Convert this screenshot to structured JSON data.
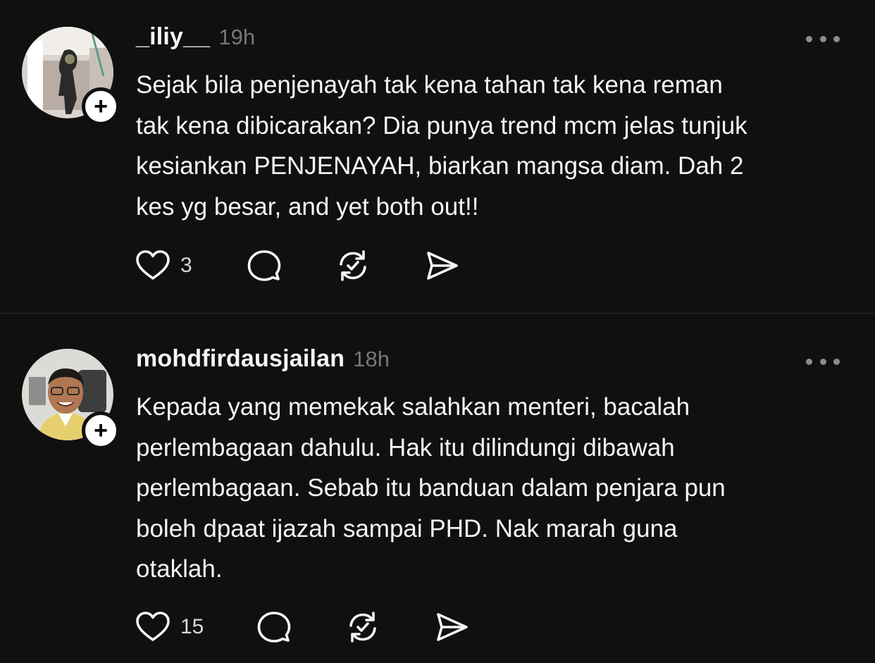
{
  "posts": [
    {
      "username": "_iliy__",
      "time": "19h",
      "text": "Sejak bila penjenayah tak kena tahan tak kena reman\ntak kena dibicarakan? Dia punya trend mcm jelas tunjuk\nkesiankan PENJENAYAH, biarkan mangsa diam. Dah 2\nkes yg besar, and yet both out!!",
      "like_count": "3",
      "follow_symbol": "+"
    },
    {
      "username": "mohdfirdausjailan",
      "time": "18h",
      "text": "Kepada yang memekak salahkan menteri, bacalah\nperlembagaan dahulu. Hak itu dilindungi dibawah\nperlembagaan. Sebab itu banduan dalam penjara pun\nboleh dpaat ijazah sampai PHD. Nak marah guna\notaklah.",
      "like_count": "15",
      "follow_symbol": "+"
    }
  ],
  "icons": {
    "like": "heart-icon",
    "reply": "comment-bubble-icon",
    "repost": "repost-icon",
    "share": "send-icon",
    "more": "more-dots-icon"
  },
  "colors": {
    "background": "#101010",
    "text": "#f3f5f7",
    "muted": "#777777",
    "divider": "#2d2d2d"
  }
}
